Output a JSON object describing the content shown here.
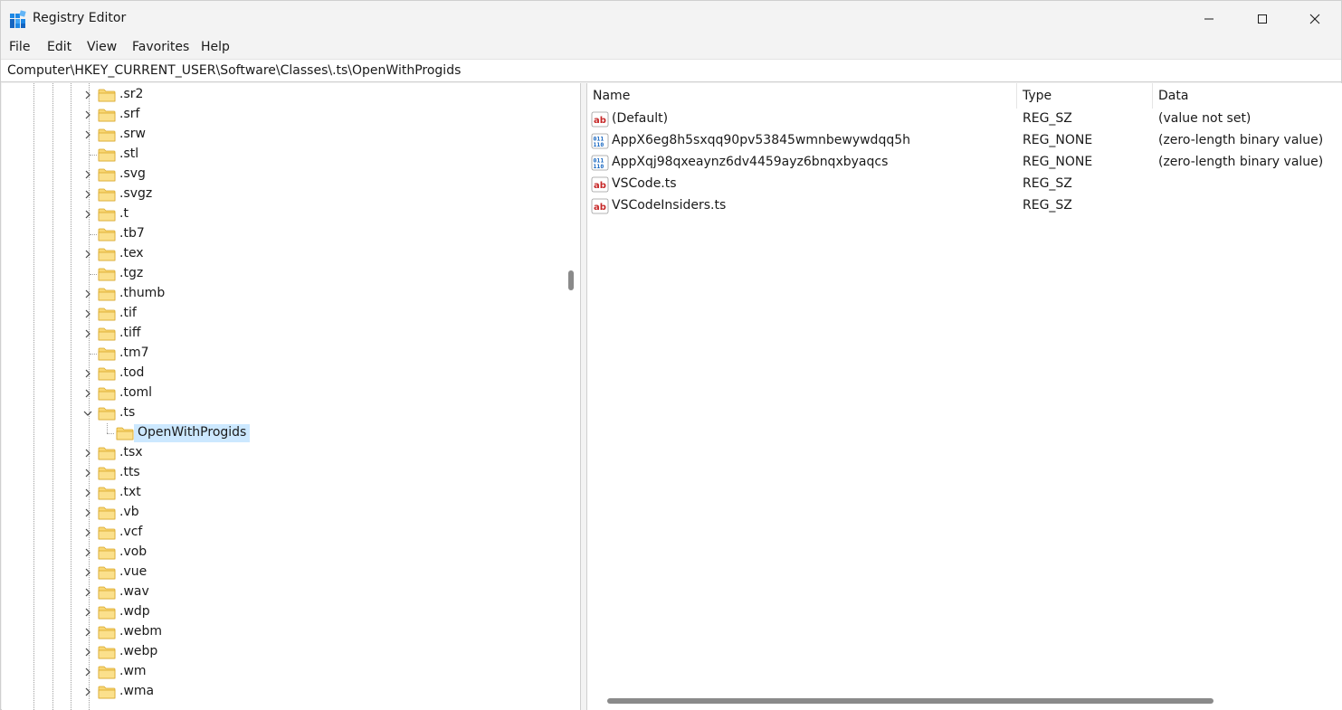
{
  "window": {
    "title": "Registry Editor",
    "controls": {
      "minimize": "minimize-icon",
      "maximize": "maximize-icon",
      "close": "close-icon"
    }
  },
  "menu": [
    "File",
    "Edit",
    "View",
    "Favorites",
    "Help"
  ],
  "address": "Computer\\HKEY_CURRENT_USER\\Software\\Classes\\.ts\\OpenWithProgids",
  "tree": {
    "items": [
      {
        "label": ".sr2",
        "expandable": true
      },
      {
        "label": ".srf",
        "expandable": true
      },
      {
        "label": ".srw",
        "expandable": true
      },
      {
        "label": ".stl",
        "expandable": false
      },
      {
        "label": ".svg",
        "expandable": true
      },
      {
        "label": ".svgz",
        "expandable": true
      },
      {
        "label": ".t",
        "expandable": true
      },
      {
        "label": ".tb7",
        "expandable": false
      },
      {
        "label": ".tex",
        "expandable": true
      },
      {
        "label": ".tgz",
        "expandable": false
      },
      {
        "label": ".thumb",
        "expandable": true
      },
      {
        "label": ".tif",
        "expandable": true
      },
      {
        "label": ".tiff",
        "expandable": true
      },
      {
        "label": ".tm7",
        "expandable": false
      },
      {
        "label": ".tod",
        "expandable": true
      },
      {
        "label": ".toml",
        "expandable": true
      },
      {
        "label": ".ts",
        "expandable": true,
        "expanded": true
      },
      {
        "label": "OpenWithProgids",
        "child": true,
        "selected": true
      },
      {
        "label": ".tsx",
        "expandable": true
      },
      {
        "label": ".tts",
        "expandable": true
      },
      {
        "label": ".txt",
        "expandable": true
      },
      {
        "label": ".vb",
        "expandable": true
      },
      {
        "label": ".vcf",
        "expandable": true
      },
      {
        "label": ".vob",
        "expandable": true
      },
      {
        "label": ".vue",
        "expandable": true
      },
      {
        "label": ".wav",
        "expandable": true
      },
      {
        "label": ".wdp",
        "expandable": true
      },
      {
        "label": ".webm",
        "expandable": true
      },
      {
        "label": ".webp",
        "expandable": true
      },
      {
        "label": ".wm",
        "expandable": true
      },
      {
        "label": ".wma",
        "expandable": true
      }
    ]
  },
  "values": {
    "columns": {
      "name": "Name",
      "type": "Type",
      "data": "Data"
    },
    "rows": [
      {
        "icon": "string-value-icon",
        "name": "(Default)",
        "type": "REG_SZ",
        "data": "(value not set)"
      },
      {
        "icon": "binary-value-icon",
        "name": "AppX6eg8h5sxqq90pv53845wmnbewywdqq5h",
        "type": "REG_NONE",
        "data": "(zero-length binary value)"
      },
      {
        "icon": "binary-value-icon",
        "name": "AppXqj98qxeaynz6dv4459ayz6bnqxbyaqcs",
        "type": "REG_NONE",
        "data": "(zero-length binary value)"
      },
      {
        "icon": "string-value-icon",
        "name": "VSCode.ts",
        "type": "REG_SZ",
        "data": ""
      },
      {
        "icon": "string-value-icon",
        "name": "VSCodeInsiders.ts",
        "type": "REG_SZ",
        "data": ""
      }
    ]
  },
  "colors": {
    "selection": "#cce8ff",
    "folder": "#f8d775",
    "accent": "#0f6cbd"
  }
}
